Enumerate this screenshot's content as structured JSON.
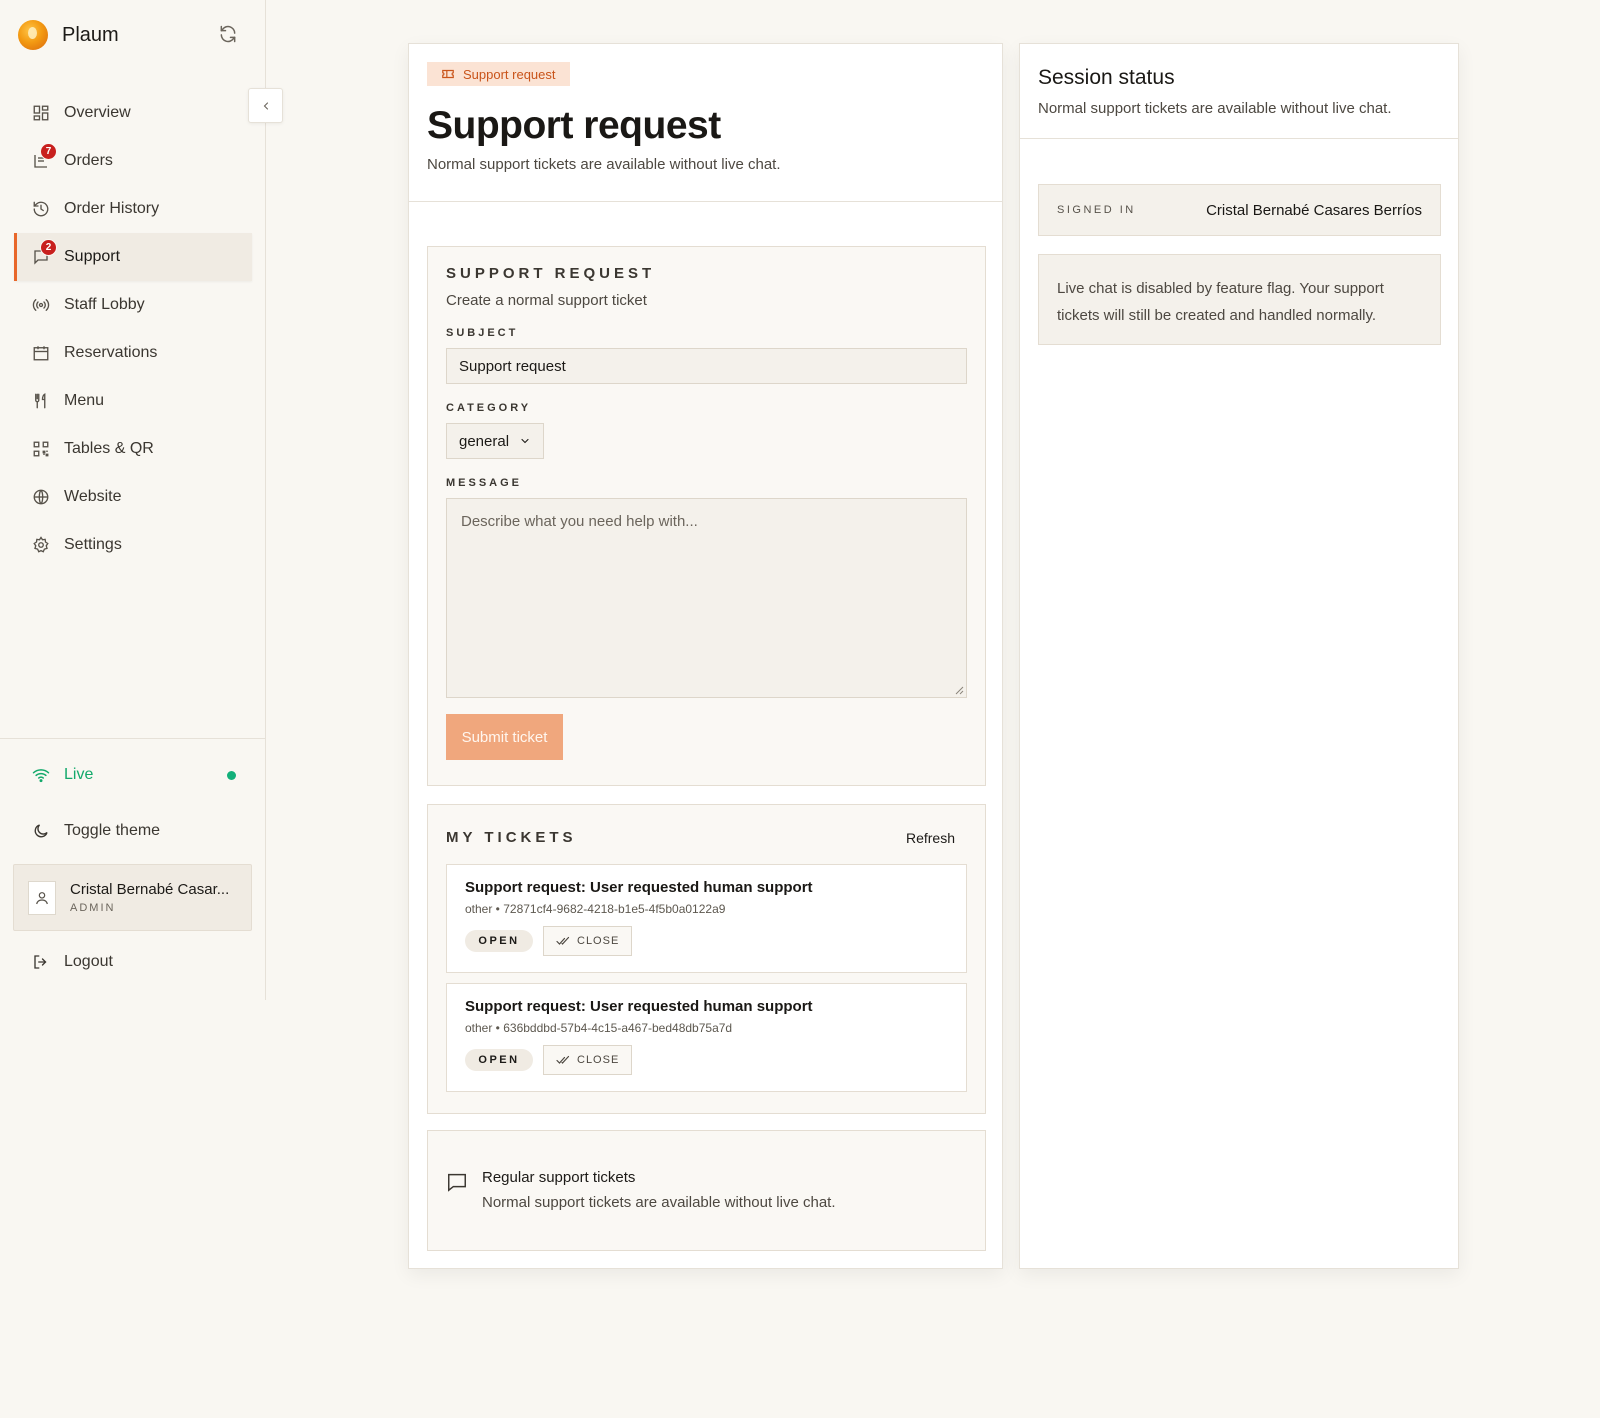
{
  "brand": {
    "name": "Plaum"
  },
  "sidebar": {
    "items": [
      {
        "label": "Overview",
        "icon": "overview-icon"
      },
      {
        "label": "Orders",
        "icon": "orders-icon",
        "badge": "7"
      },
      {
        "label": "Order History",
        "icon": "history-icon"
      },
      {
        "label": "Support",
        "icon": "support-icon",
        "badge": "2",
        "active": true
      },
      {
        "label": "Staff Lobby",
        "icon": "broadcast-icon"
      },
      {
        "label": "Reservations",
        "icon": "calendar-icon"
      },
      {
        "label": "Menu",
        "icon": "utensils-icon"
      },
      {
        "label": "Tables & QR",
        "icon": "qr-icon"
      },
      {
        "label": "Website",
        "icon": "globe-icon"
      },
      {
        "label": "Settings",
        "icon": "gear-icon"
      }
    ],
    "live_label": "Live",
    "theme_label": "Toggle theme",
    "user": {
      "name": "Cristal Bernabé Casar...",
      "role": "ADMIN"
    },
    "logout_label": "Logout"
  },
  "main": {
    "crumb": "Support request",
    "title": "Support request",
    "subtitle": "Normal support tickets are available without live chat.",
    "form": {
      "section_title": "SUPPORT REQUEST",
      "section_sub": "Create a normal support ticket",
      "subject_label": "SUBJECT",
      "subject_value": "Support request",
      "category_label": "CATEGORY",
      "category_value": "general",
      "message_label": "MESSAGE",
      "message_placeholder": "Describe what you need help with...",
      "submit_label": "Submit ticket"
    },
    "tickets": {
      "title": "MY TICKETS",
      "refresh_label": "Refresh",
      "items": [
        {
          "title": "Support request: User requested human support",
          "meta": "other • 72871cf4-9682-4218-b1e5-4f5b0a0122a9",
          "status": "OPEN",
          "close_label": "CLOSE"
        },
        {
          "title": "Support request: User requested human support",
          "meta": "other • 636bddbd-57b4-4c15-a467-bed48db75a7d",
          "status": "OPEN",
          "close_label": "CLOSE"
        }
      ]
    },
    "info": {
      "title": "Regular support tickets",
      "sub": "Normal support tickets are available without live chat."
    }
  },
  "session": {
    "title": "Session status",
    "sub": "Normal support tickets are available without live chat.",
    "signed_label": "SIGNED IN",
    "signed_value": "Cristal Bernabé Casares Berríos",
    "flag_text": "Live chat is disabled by feature flag. Your support tickets will still be created and handled normally."
  },
  "colors": {
    "accent": "#e8672a",
    "live": "#13a96b",
    "badge": "#c8201e",
    "submit": "#f0a77d"
  }
}
